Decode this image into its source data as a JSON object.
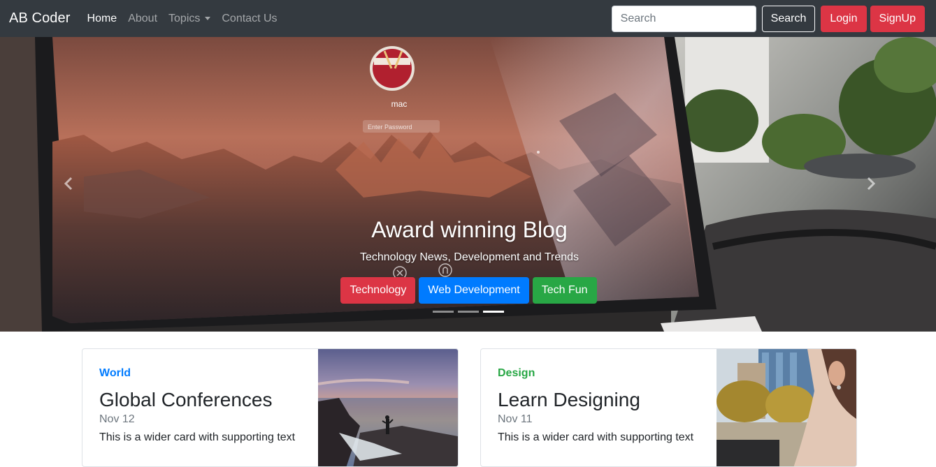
{
  "navbar": {
    "brand": "AB Coder",
    "links": [
      {
        "label": "Home"
      },
      {
        "label": "About"
      },
      {
        "label": "Topics"
      },
      {
        "label": "Contact Us"
      }
    ],
    "search_placeholder": "Search",
    "search_button": "Search",
    "login_button": "Login",
    "signup_button": "SignUp"
  },
  "carousel": {
    "title": "Award winning Blog",
    "subtitle": "Technology News, Development and Trends",
    "buttons": [
      "Technology",
      "Web Development",
      "Tech Fun"
    ],
    "slide_count": 3,
    "active_slide": 3,
    "screen_user": "mac",
    "screen_password_placeholder": "Enter Password"
  },
  "cards": [
    {
      "category": "World",
      "title": "Global Conferences",
      "date": "Nov 12",
      "text": "This is a wider card with supporting text"
    },
    {
      "category": "Design",
      "title": "Learn Designing",
      "date": "Nov 11",
      "text": "This is a wider card with supporting text"
    }
  ],
  "colors": {
    "navbar_bg": "#343a40",
    "danger": "#dc3545",
    "primary": "#007bff",
    "success": "#28a745"
  }
}
